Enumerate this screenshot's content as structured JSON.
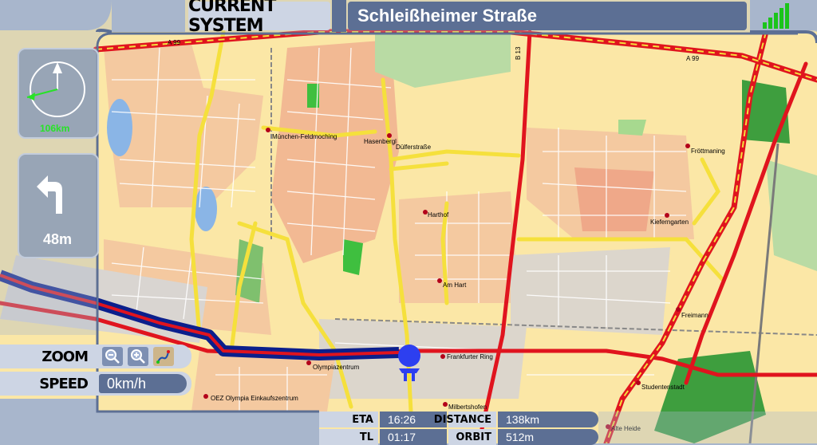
{
  "header": {
    "title": "CURRENT SYSTEM",
    "street": "Schleißheimer Straße"
  },
  "compass": {
    "distance": "106km"
  },
  "turn": {
    "distance": "48m"
  },
  "controls": {
    "zoom_label": "ZOOM",
    "speed_label": "SPEED",
    "speed_value": "0km/h"
  },
  "status": {
    "eta_label": "ETA",
    "eta_value": "16:26",
    "distance_label": "DISTANCE",
    "distance_value": "138km",
    "tl_label": "TL",
    "tl_value": "01:17",
    "orbit_label": "ORBIT",
    "orbit_value": "512m"
  },
  "map": {
    "places": [
      "München-Feldmoching",
      "Hasenbergl",
      "Dülferstraße",
      "Harthof",
      "Am Hart",
      "Kieferngarten",
      "Fröttmaning",
      "Freimann",
      "Frankfurter Ring",
      "Olympiazentrum",
      "OEZ Olympia Einkaufszentrum",
      "Milbertshofen",
      "Studentenstadt",
      "Alte Heide"
    ],
    "roads": [
      "A 99",
      "B 13"
    ]
  },
  "colors": {
    "panel": "#5c6f94",
    "label_bg": "#cdd5e4",
    "route": "#e0141e",
    "signal": "#1bc41b"
  }
}
